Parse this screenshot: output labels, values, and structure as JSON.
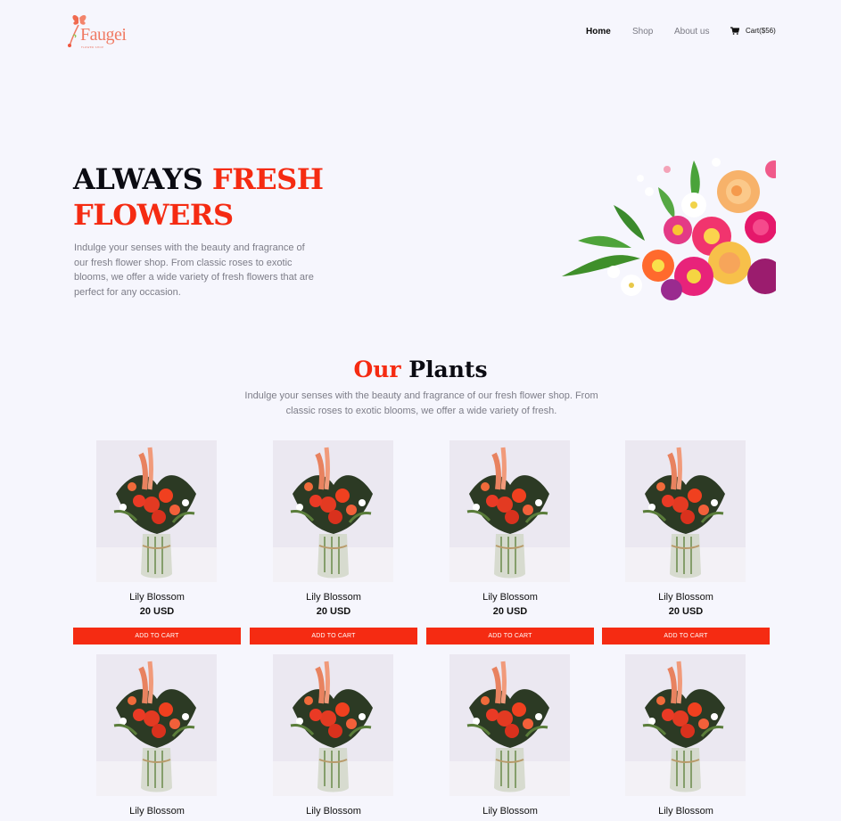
{
  "header": {
    "logo_text": "Faugei",
    "logo_tagline": "FLOWER SHOP",
    "nav": [
      {
        "label": "Home",
        "active": true
      },
      {
        "label": "Shop",
        "active": false
      },
      {
        "label": "About us",
        "active": false
      }
    ],
    "cart_label": "Cart($56)"
  },
  "hero": {
    "title_line1_plain": "ALWAYS ",
    "title_line1_accent": "FRESH",
    "title_line2_accent": "FLOWERS",
    "description": "Indulge your senses with the beauty and fragrance of our fresh flower shop. From classic roses to exotic blooms, we offer a wide variety of fresh flowers that are perfect for any occasion."
  },
  "section": {
    "title_accent": "Our",
    "title_plain": " Plants",
    "description": "Indulge your senses with the beauty and fragrance of our fresh flower shop. From classic roses to exotic blooms, we offer a wide variety of fresh."
  },
  "products": [
    {
      "name": "Lily Blossom",
      "price": "20 USD",
      "button": "ADD TO CART"
    },
    {
      "name": "Lily Blossom",
      "price": "20 USD",
      "button": "ADD TO CART"
    },
    {
      "name": "Lily Blossom",
      "price": "20 USD",
      "button": "ADD TO CART"
    },
    {
      "name": "Lily Blossom",
      "price": "20 USD",
      "button": "ADD TO CART"
    },
    {
      "name": "Lily Blossom",
      "price": "",
      "button": ""
    },
    {
      "name": "Lily Blossom",
      "price": "",
      "button": ""
    },
    {
      "name": "Lily Blossom",
      "price": "",
      "button": ""
    },
    {
      "name": "Lily Blossom",
      "price": "",
      "button": ""
    }
  ],
  "colors": {
    "accent": "#f52b12",
    "background": "#f6f6fd",
    "muted_text": "#7d7d88"
  }
}
